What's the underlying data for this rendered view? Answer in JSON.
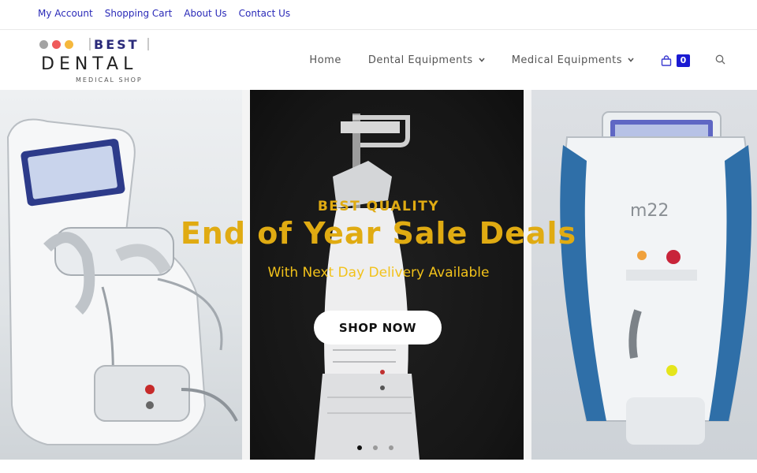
{
  "topbar": {
    "links": [
      "My Account",
      "Shopping Cart",
      "About Us",
      "Contact Us"
    ]
  },
  "logo": {
    "word1": "BEST",
    "word2": "DENTAL",
    "tagline": "MEDICAL SHOP",
    "dot_colors": [
      "#a3a3a3",
      "#ef5b5b",
      "#f5b83d"
    ]
  },
  "nav": {
    "home": "Home",
    "dental": "Dental Equipments",
    "medical": "Medical Equipments",
    "cart_count": "0",
    "chevron": "⌄"
  },
  "hero": {
    "kicker": "BEST QUALITY",
    "headline": "End of Year Sale Deals",
    "subline": "With Next Day Delivery Available",
    "button": "SHOP NOW",
    "slides": 3,
    "active_slide": 1,
    "accent_color": "#e0ab12"
  },
  "icons": {
    "cart": "shopping-bag-icon",
    "search": "search-icon"
  }
}
